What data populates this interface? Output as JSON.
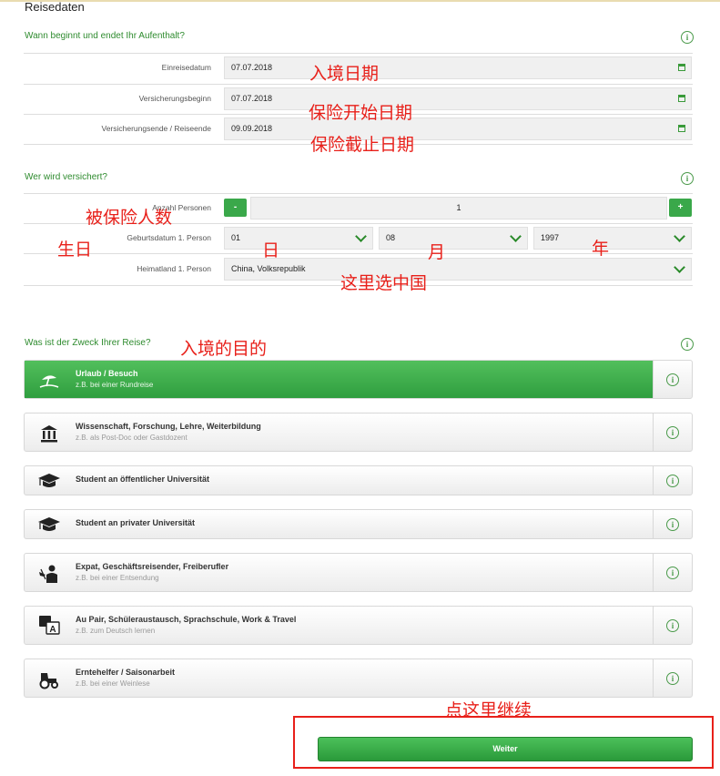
{
  "page": {
    "title": "Reisedaten"
  },
  "stay": {
    "heading": "Wann beginnt und endet Ihr Aufenthalt?",
    "rows": [
      {
        "label": "Einreisedatum",
        "value": "07.07.2018"
      },
      {
        "label": "Versicherungsbeginn",
        "value": "07.07.2018"
      },
      {
        "label": "Versicherungsende / Reiseende",
        "value": "09.09.2018"
      }
    ]
  },
  "insured": {
    "heading": "Wer wird versichert?",
    "count_label": "Anzahl Personen",
    "count_value": "1",
    "minus": "-",
    "plus": "+",
    "birth_label": "Geburtsdatum 1. Person",
    "birth_day": "01",
    "birth_month": "08",
    "birth_year": "1997",
    "country_label": "Heimatland 1. Person",
    "country_value": "China, Volksrepublik"
  },
  "purpose": {
    "heading": "Was ist der Zweck Ihrer Reise?",
    "options": [
      {
        "title": "Urlaub / Besuch",
        "subtitle": "z.B. bei einer Rundreise",
        "icon": "beach-umbrella-icon",
        "selected": true
      },
      {
        "title": "Wissenschaft, Forschung, Lehre, Weiterbildung",
        "subtitle": "z.B. als Post-Doc oder Gastdozent",
        "icon": "institution-icon",
        "selected": false
      },
      {
        "title": "Student an öffentlicher Universität",
        "subtitle": "",
        "icon": "graduation-cap-icon",
        "selected": false
      },
      {
        "title": "Student an privater Universität",
        "subtitle": "",
        "icon": "graduation-cap-icon",
        "selected": false
      },
      {
        "title": "Expat, Geschäftsreisender, Freiberufler",
        "subtitle": "z.B. bei einer Entsendung",
        "icon": "business-traveler-icon",
        "selected": false
      },
      {
        "title": "Au Pair, Schüleraustausch, Sprachschule, Work & Travel",
        "subtitle": "z.B. zum Deutsch lernen",
        "icon": "translate-icon",
        "selected": false
      },
      {
        "title": "Erntehelfer / Saisonarbeit",
        "subtitle": "z.B. bei einer Weinlese",
        "icon": "tractor-icon",
        "selected": false
      }
    ]
  },
  "actions": {
    "continue_label": "Weiter"
  },
  "annotations": {
    "entry_date": "入境日期",
    "insurance_start": "保险开始日期",
    "insurance_end": "保险截止日期",
    "insured_count": "被保险人数",
    "birthday": "生日",
    "day": "日",
    "month": "月",
    "year": "年",
    "choose_china": "这里选中国",
    "entry_purpose": "入境的目的",
    "click_continue": "点这里继续"
  },
  "colors": {
    "accent": "#3aa84a",
    "heading": "#2e8b2e",
    "annotation": "#e8201a"
  }
}
